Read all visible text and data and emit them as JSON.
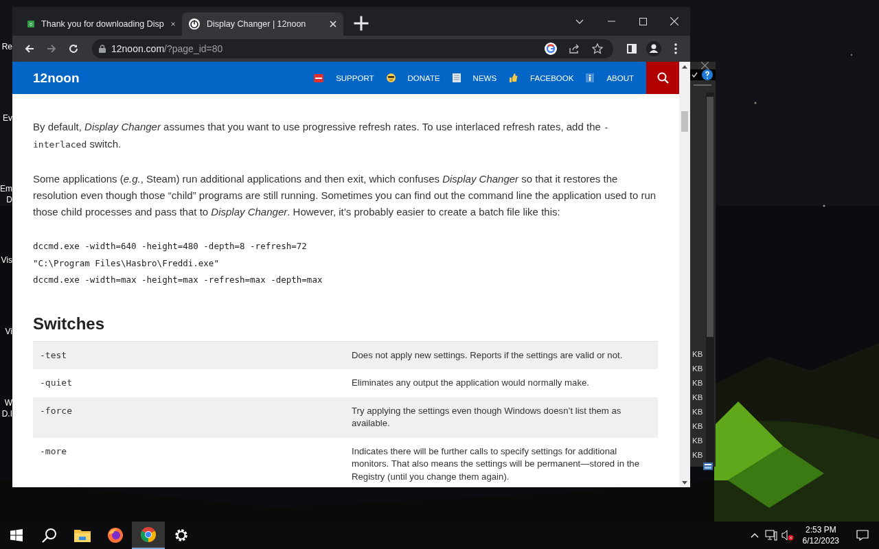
{
  "desktop": {
    "icon_labels": [
      {
        "lines": [
          "Re"
        ]
      },
      {
        "lines": [
          "Ev"
        ]
      },
      {
        "lines": [
          "Em",
          "D"
        ]
      },
      {
        "lines": [
          "Vis"
        ]
      },
      {
        "lines": [
          "Vi"
        ]
      },
      {
        "lines": [
          "W",
          "D.I"
        ]
      }
    ]
  },
  "background_window": {
    "sizes": [
      "KB",
      "KB",
      "KB",
      "KB",
      "KB",
      "KB",
      "KB",
      "KB"
    ]
  },
  "browser": {
    "tabs": [
      {
        "title": "Thank you for downloading Disp",
        "kind": "download",
        "selected": false
      },
      {
        "title": "Display Changer | 12noon",
        "kind": "power",
        "selected": true
      }
    ],
    "nav_buttons": [
      {
        "kind": "back",
        "disabled": false
      },
      {
        "kind": "forward",
        "disabled": true
      },
      {
        "kind": "reload",
        "disabled": false
      }
    ],
    "address": {
      "host": "12noon.com",
      "path": "/?page_id=80"
    }
  },
  "site": {
    "logo": "12noon",
    "menu": [
      {
        "label": "SUPPORT",
        "kind": "sos"
      },
      {
        "label": "DONATE",
        "kind": "smiley"
      },
      {
        "label": "NEWS",
        "kind": "newspaper"
      },
      {
        "label": "FACEBOOK",
        "kind": "thumb"
      },
      {
        "label": "ABOUT",
        "kind": "info"
      }
    ],
    "paragraphs": [
      [
        {
          "kind": "text",
          "text": "By default, *Display Changer* assumes that you want to use progressive refresh rates. To use interlaced refresh rates, add the "
        },
        {
          "kind": "code",
          "text": "-interlaced"
        },
        {
          "kind": "text",
          "text": " switch."
        }
      ],
      [
        {
          "kind": "text",
          "text": "Some applications (*e.g.*, Steam) run additional applications and then exit, which confuses *Display Changer* so that it restores the resolution even though those “child” programs are still running. Sometimes you can find out the command line the application used to run those child processes and pass that to *Display Changer*. However, it’s probably easier to create a batch file like this:"
        }
      ]
    ],
    "code_lines": [
      "dccmd.exe -width=640 -height=480 -depth=8 -refresh=72",
      "\"C:\\Program Files\\Hasbro\\Freddi.exe\"",
      "dccmd.exe -width=max -height=max -refresh=max -depth=max"
    ],
    "heading": "Switches",
    "switches": [
      {
        "switch": "-test",
        "description": "Does not apply new settings. Reports if the settings are valid or not."
      },
      {
        "switch": "-quiet",
        "description": "Eliminates any output the application would normally make."
      },
      {
        "switch": "-force",
        "description": "Try applying the settings even though Windows doesn’t list them as available."
      },
      {
        "switch": "-more",
        "description": "Indicates there will be further calls to specify settings for additional monitors. That also means the settings will be permanent—stored in the Registry (until you change them again)."
      }
    ]
  },
  "taskbar": {
    "apps": [
      {
        "kind": "explorer",
        "selected": false
      },
      {
        "kind": "firefox",
        "selected": false
      },
      {
        "kind": "chrome",
        "selected": true
      },
      {
        "kind": "settings",
        "selected": false
      }
    ],
    "time": "2:53 PM",
    "date": "6/12/2023"
  }
}
